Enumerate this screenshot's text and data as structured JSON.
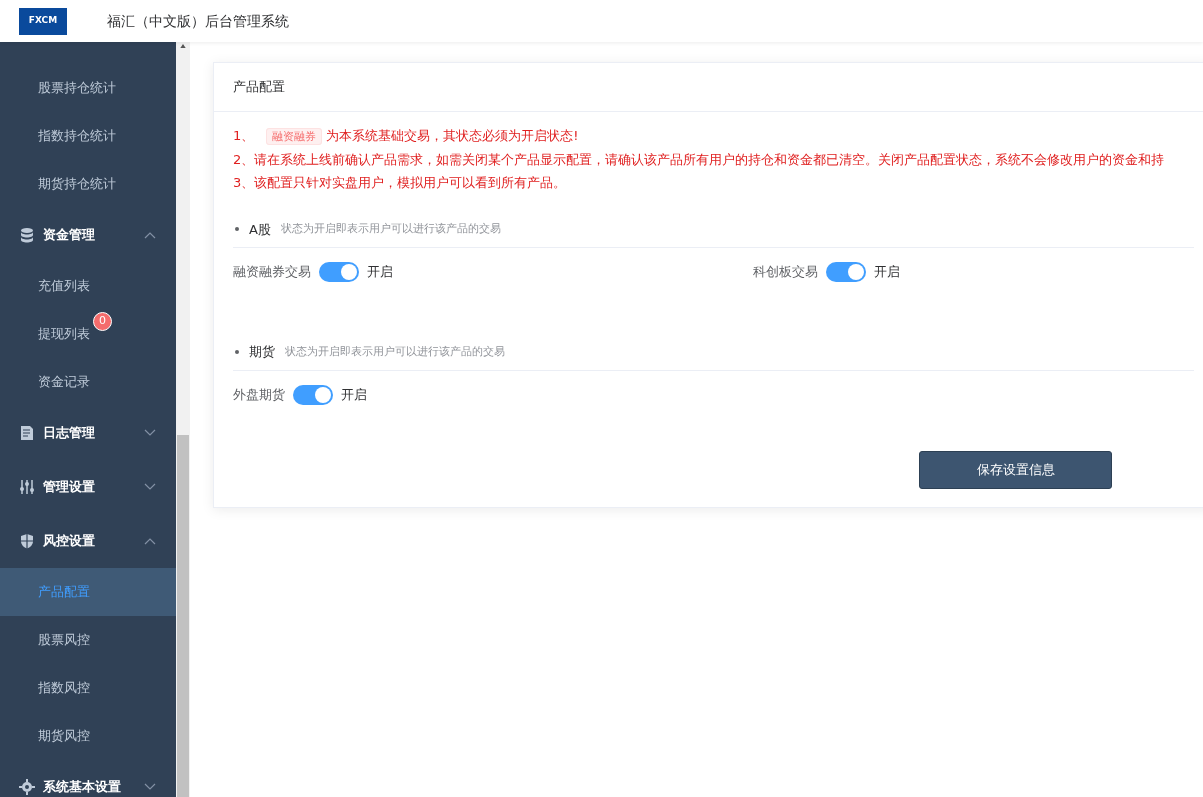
{
  "header": {
    "logo_text": "FXCM",
    "title": "福汇（中文版）后台管理系统"
  },
  "sidebar": {
    "items": [
      {
        "kind": "sub",
        "label": "股票持仓统计",
        "selected": false
      },
      {
        "kind": "sub",
        "label": "指数持仓统计",
        "selected": false
      },
      {
        "kind": "sub",
        "label": "期货持仓统计",
        "selected": false
      },
      {
        "kind": "group",
        "label": "资金管理",
        "expanded": true
      },
      {
        "kind": "sub",
        "label": "充值列表",
        "selected": false
      },
      {
        "kind": "sub",
        "label": "提现列表",
        "selected": false,
        "badge": "0"
      },
      {
        "kind": "sub",
        "label": "资金记录",
        "selected": false
      },
      {
        "kind": "group",
        "label": "日志管理",
        "expanded": false
      },
      {
        "kind": "group",
        "label": "管理设置",
        "expanded": false
      },
      {
        "kind": "group",
        "label": "风控设置",
        "expanded": true
      },
      {
        "kind": "sub",
        "label": "产品配置",
        "selected": true
      },
      {
        "kind": "sub",
        "label": "股票风控",
        "selected": false
      },
      {
        "kind": "sub",
        "label": "指数风控",
        "selected": false
      },
      {
        "kind": "sub",
        "label": "期货风控",
        "selected": false
      },
      {
        "kind": "group",
        "label": "系统基本设置",
        "expanded": false
      }
    ]
  },
  "card": {
    "title": "产品配置",
    "notes": [
      {
        "prefix": "1、",
        "tag": "融资融券",
        "text": "为本系统基础交易，其状态必须为开启状态!"
      },
      {
        "text": "2、请在系统上线前确认产品需求，如需关闭某个产品显示配置，请确认该产品所有用户的持仓和资金都已清空。关闭产品配置状态，系统不会修改用户的资金和持"
      },
      {
        "text": "3、该配置只针对实盘用户，模拟用户可以看到所有产品。"
      }
    ],
    "sections": [
      {
        "title": "A股",
        "hint": "状态为开启即表示用户可以进行该产品的交易",
        "switches": [
          {
            "label": "融资融券交易",
            "on": true,
            "state_text": "开启"
          },
          {
            "label": "科创板交易",
            "on": true,
            "state_text": "开启"
          }
        ]
      },
      {
        "title": "期货",
        "hint": "状态为开启即表示用户可以进行该产品的交易",
        "switches": [
          {
            "label": "外盘期货",
            "on": true,
            "state_text": "开启"
          }
        ]
      }
    ],
    "save_button": "保存设置信息"
  }
}
